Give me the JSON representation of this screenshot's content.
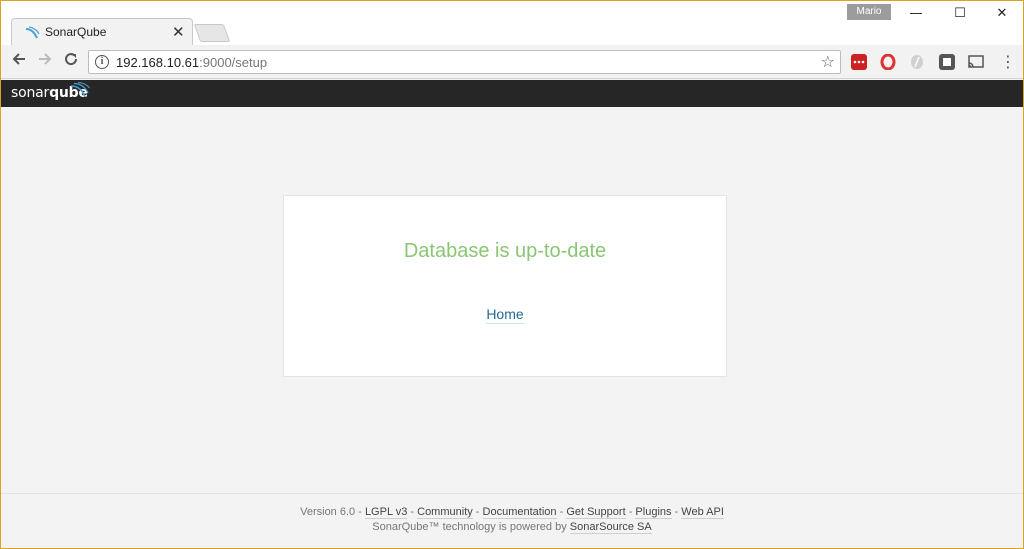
{
  "browser": {
    "tab_title": "SonarQube",
    "tab_close": "✕",
    "profile_name": "Mario",
    "window_controls": {
      "minimize": "—",
      "maximize": "☐",
      "close": "✕"
    },
    "url_host": "192.168.10.61",
    "url_path": ":9000/setup",
    "icons": {
      "back": "arrow-left-icon",
      "forward": "arrow-right-icon",
      "reload": "reload-icon",
      "info": "info-icon",
      "star": "star-icon",
      "menu": "menu-dots-icon"
    },
    "extension_colors": [
      "#cc2222",
      "#e03030",
      "#bdbdbd",
      "#555555",
      "#555555"
    ]
  },
  "app": {
    "logo_text_light": "sonar",
    "logo_text_bold": "qube",
    "accent": "#4b9fd5"
  },
  "main": {
    "status_title": "Database is up-to-date",
    "status_color": "#8bc773",
    "home_link": "Home"
  },
  "footer": {
    "version": "Version 6.0",
    "links": [
      "LGPL v3",
      "Community",
      "Documentation",
      "Get Support",
      "Plugins",
      "Web API"
    ],
    "separator": " - ",
    "powered_prefix": "SonarQube™ technology is powered by ",
    "powered_link": "SonarSource SA"
  }
}
